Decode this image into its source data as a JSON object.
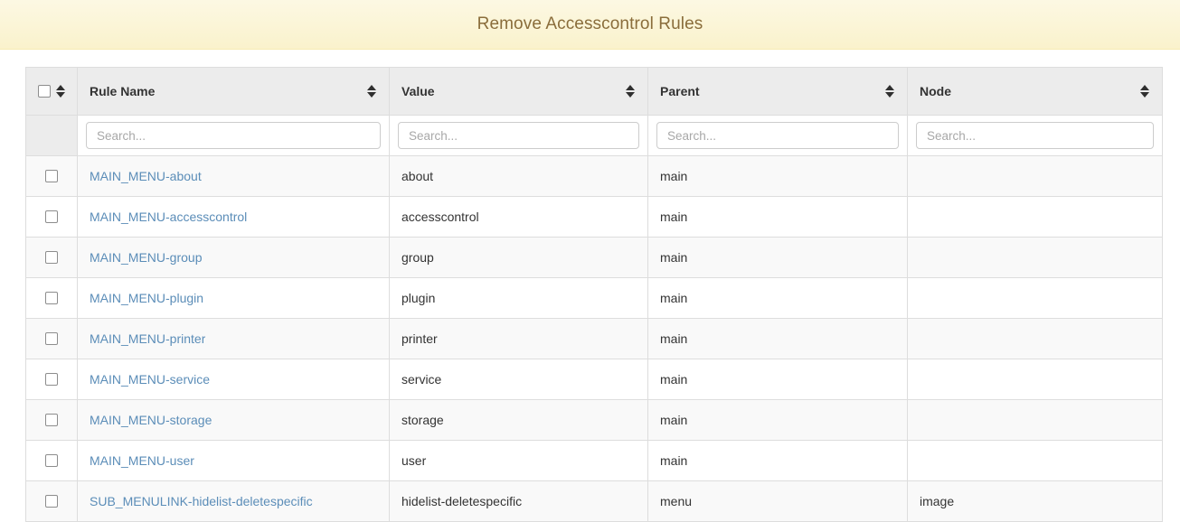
{
  "banner": {
    "title": "Remove Accesscontrol Rules",
    "background_color": "#faf2cc",
    "text_color": "#8a6d3b"
  },
  "table": {
    "select_all_checkbox_name": "select-all",
    "columns": [
      {
        "key": "check",
        "label": "",
        "sortable": true
      },
      {
        "key": "rule",
        "label": "Rule Name",
        "sortable": true
      },
      {
        "key": "value",
        "label": "Value",
        "sortable": true
      },
      {
        "key": "parent",
        "label": "Parent",
        "sortable": true
      },
      {
        "key": "node",
        "label": "Node",
        "sortable": true
      }
    ],
    "filters": {
      "rule_placeholder": "Search...",
      "value_placeholder": "Search...",
      "parent_placeholder": "Search...",
      "node_placeholder": "Search...",
      "rule_value": "",
      "value_value": "",
      "parent_value": "",
      "node_value": ""
    },
    "link_color": "#5b8db8",
    "rows": [
      {
        "rule": "MAIN_MENU-about",
        "value": "about",
        "parent": "main",
        "node": ""
      },
      {
        "rule": "MAIN_MENU-accesscontrol",
        "value": "accesscontrol",
        "parent": "main",
        "node": ""
      },
      {
        "rule": "MAIN_MENU-group",
        "value": "group",
        "parent": "main",
        "node": ""
      },
      {
        "rule": "MAIN_MENU-plugin",
        "value": "plugin",
        "parent": "main",
        "node": ""
      },
      {
        "rule": "MAIN_MENU-printer",
        "value": "printer",
        "parent": "main",
        "node": ""
      },
      {
        "rule": "MAIN_MENU-service",
        "value": "service",
        "parent": "main",
        "node": ""
      },
      {
        "rule": "MAIN_MENU-storage",
        "value": "storage",
        "parent": "main",
        "node": ""
      },
      {
        "rule": "MAIN_MENU-user",
        "value": "user",
        "parent": "main",
        "node": ""
      },
      {
        "rule": "SUB_MENULINK-hidelist-deletespecific",
        "value": "hidelist-deletespecific",
        "parent": "menu",
        "node": "image"
      }
    ]
  }
}
